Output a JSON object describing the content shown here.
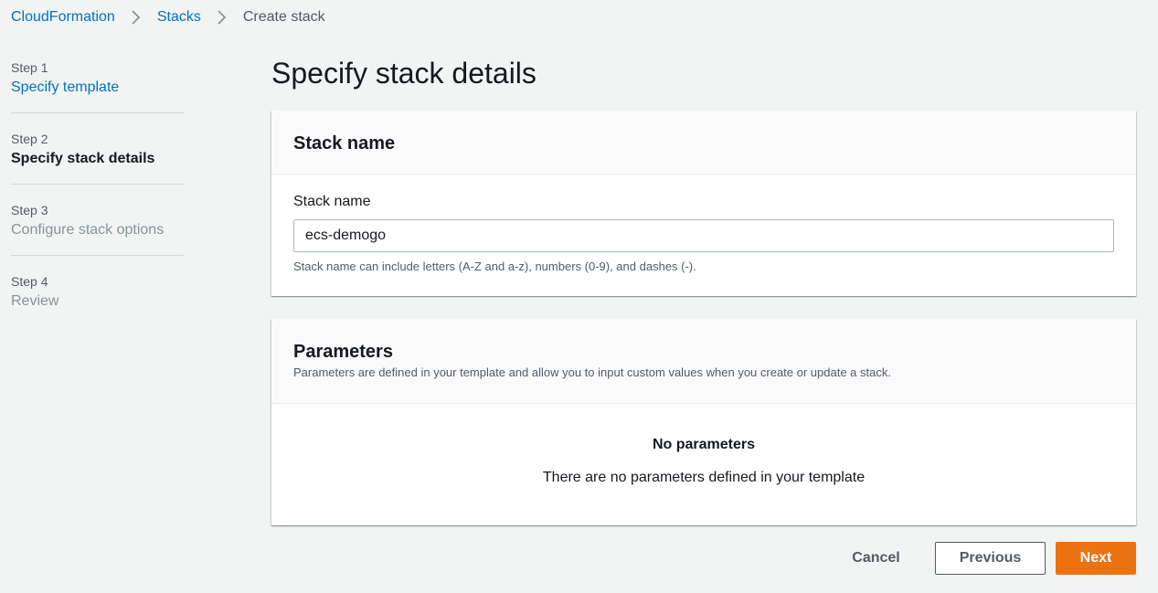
{
  "breadcrumb": {
    "items": [
      "CloudFormation",
      "Stacks"
    ],
    "current": "Create stack"
  },
  "steps": [
    {
      "number": "Step 1",
      "title": "Specify template",
      "state": "link"
    },
    {
      "number": "Step 2",
      "title": "Specify stack details",
      "state": "active"
    },
    {
      "number": "Step 3",
      "title": "Configure stack options",
      "state": "disabled"
    },
    {
      "number": "Step 4",
      "title": "Review",
      "state": "disabled"
    }
  ],
  "page_title": "Specify stack details",
  "stack_panel": {
    "heading": "Stack name",
    "field_label": "Stack name",
    "field_value": "ecs-demogo",
    "hint": "Stack name can include letters (A-Z and a-z), numbers (0-9), and dashes (-)."
  },
  "params_panel": {
    "heading": "Parameters",
    "description": "Parameters are defined in your template and allow you to input custom values when you create or update a stack.",
    "empty_title": "No parameters",
    "empty_desc": "There are no parameters defined in your template"
  },
  "actions": {
    "cancel": "Cancel",
    "previous": "Previous",
    "next": "Next"
  },
  "colors": {
    "link": "#0073bb",
    "primary_button": "#ec7211",
    "background": "#f2f3f3"
  },
  "icons": {
    "breadcrumb_separator": "chevron-right-icon"
  }
}
